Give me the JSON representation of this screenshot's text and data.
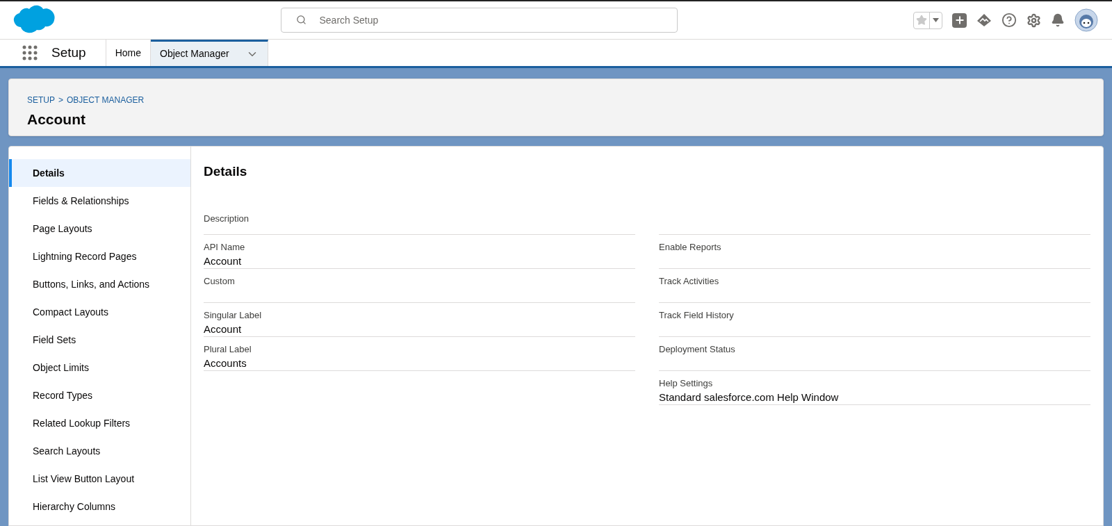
{
  "header": {
    "search": {
      "placeholder": "Search Setup"
    }
  },
  "nav": {
    "app_name": "Setup",
    "tabs": [
      {
        "label": "Home",
        "selected": false,
        "menu": false
      },
      {
        "label": "Object Manager",
        "selected": true,
        "menu": true
      }
    ]
  },
  "page_header": {
    "breadcrumbs": [
      "SETUP",
      ">",
      "OBJECT MANAGER"
    ],
    "title": "Account"
  },
  "sidebar": {
    "items": [
      {
        "label": "Details",
        "selected": true
      },
      {
        "label": "Fields & Relationships",
        "selected": false
      },
      {
        "label": "Page Layouts",
        "selected": false
      },
      {
        "label": "Lightning Record Pages",
        "selected": false
      },
      {
        "label": "Buttons, Links, and Actions",
        "selected": false
      },
      {
        "label": "Compact Layouts",
        "selected": false
      },
      {
        "label": "Field Sets",
        "selected": false
      },
      {
        "label": "Object Limits",
        "selected": false
      },
      {
        "label": "Record Types",
        "selected": false
      },
      {
        "label": "Related Lookup Filters",
        "selected": false
      },
      {
        "label": "Search Layouts",
        "selected": false
      },
      {
        "label": "List View Button Layout",
        "selected": false
      },
      {
        "label": "Hierarchy Columns",
        "selected": false
      }
    ]
  },
  "details": {
    "title": "Details",
    "left_fields": [
      {
        "label": "Description"
      },
      {
        "label": "API Name",
        "value": "Account"
      },
      {
        "label": "Custom"
      },
      {
        "label": "Singular Label",
        "value": "Account"
      },
      {
        "label": "Plural Label",
        "value": "Accounts"
      }
    ],
    "right_fields": [
      {
        "label": "Enable Reports"
      },
      {
        "label": "Track Activities"
      },
      {
        "label": "Track Field History"
      },
      {
        "label": "Deployment Status"
      },
      {
        "label": "Help Settings",
        "value": "Standard salesforce.com Help Window"
      }
    ]
  }
}
